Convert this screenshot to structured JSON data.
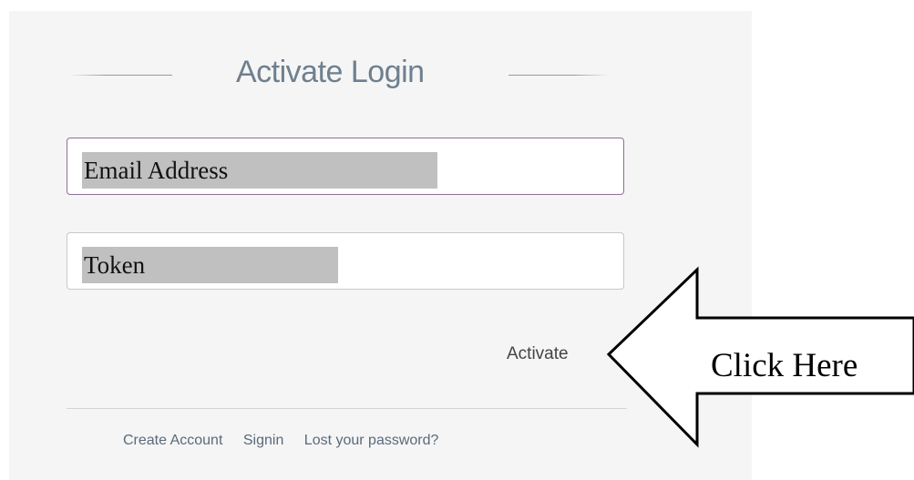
{
  "form": {
    "title": "Activate Login",
    "email_value": "Email Address",
    "token_value": "Token",
    "activate_label": "Activate"
  },
  "footer": {
    "links": [
      "Create Account",
      "Signin",
      "Lost your password?"
    ]
  },
  "callout": {
    "label": "Click Here"
  }
}
